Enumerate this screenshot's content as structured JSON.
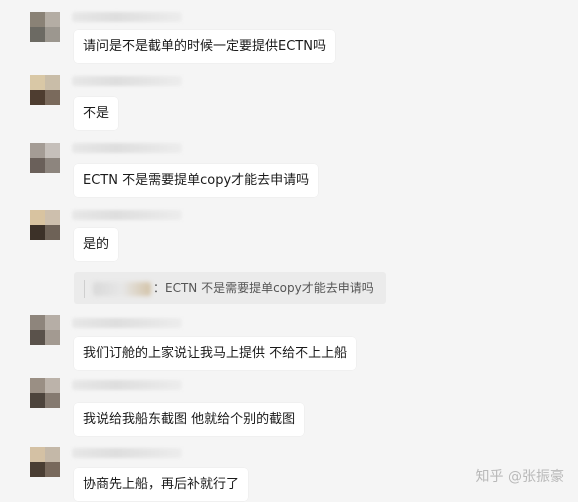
{
  "messages": [
    {
      "text": "请问是不是截单的时候一定要提供ECTN吗"
    },
    {
      "text": "不是"
    },
    {
      "text": "ECTN 不是需要提单copy才能去申请吗"
    },
    {
      "text": "是的"
    },
    {
      "text": "我们订舱的上家说让我马上提供 不给不上上船"
    },
    {
      "text": "我说给我船东截图 他就给个别的截图"
    },
    {
      "text": "协商先上船，再后补就行了"
    }
  ],
  "quote": {
    "text": "：ECTN 不是需要提单copy才能去申请吗"
  },
  "watermark": {
    "text": "知乎 @张振豪"
  }
}
